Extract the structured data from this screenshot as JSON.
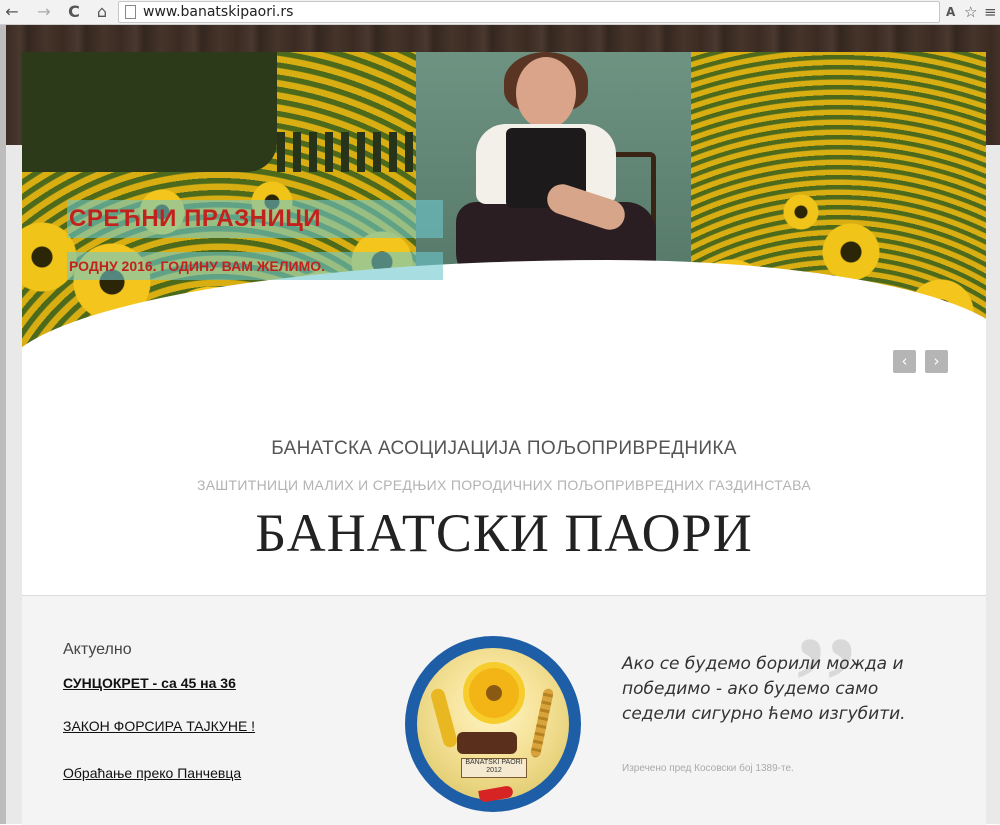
{
  "browser": {
    "url": "www.banatskipaori.rs",
    "back_icon": "←",
    "forward_icon": "→",
    "reload_icon": "C",
    "home_icon": "⌂",
    "translate_icon": "A",
    "star_icon": "☆",
    "menu_icon": "≡"
  },
  "slider": {
    "caption_title": "СРЕЋНИ ПРАЗНИЦИ",
    "caption_text": "РОДНУ 2016. ГОДИНУ ВАМ ЖЕЛИМО.",
    "prev_icon": "‹",
    "next_icon": "›"
  },
  "header": {
    "association": "БАНАТСКА АСОЦИЈАЦИЈА ПОЉОПРИВРЕДНИКА",
    "tagline": "ЗАШТИТНИЦИ МАЛИХ И СРЕДЊИХ ПОРОДИЧНИХ ПОЉОПРИВРЕДНИХ ГАЗДИНСТАВА",
    "site_name": "БАНАТСКИ ПАОРИ"
  },
  "news": {
    "title": "Актуелно",
    "items": [
      {
        "label": "СУНЦОКРЕТ - са 45 на 36"
      },
      {
        "label": "ЗАКОН ФОРСИРА ТАЈКУНЕ !"
      },
      {
        "label": "Обраћање преко Панчевца"
      }
    ]
  },
  "logo": {
    "plank_text": "BANATSKI PAORI 2012"
  },
  "quote": {
    "mark": "”",
    "text": "Ако се будемо борили можда и победимо - ако будемо само седели сигурно ћемо изгубити.",
    "source": "Изречено пред Косовски бој 1389-те."
  },
  "colors": {
    "caption_red": "#c2221e",
    "caption_bg": "#6ec8cd",
    "logo_blue": "#1e5ea6"
  }
}
